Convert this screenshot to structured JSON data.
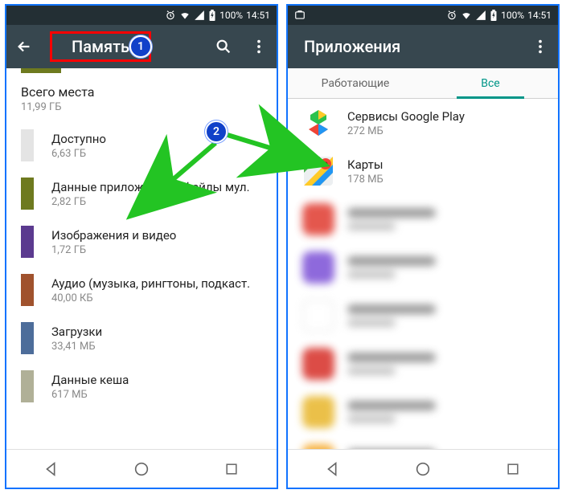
{
  "status": {
    "battery_pct": "100%",
    "time": "14:51"
  },
  "callouts": {
    "one": "1",
    "two": "2"
  },
  "left": {
    "title": "Память",
    "total": {
      "label": "Всего места",
      "value": "11,99 ГБ"
    },
    "rows": [
      {
        "label": "Доступно",
        "value": "6,63 ГБ",
        "color": "#e4e4e4"
      },
      {
        "label": "Данные приложений и файлы мул.",
        "value": "2,82 ГБ",
        "color": "#6e7a1f"
      },
      {
        "label": "Изображения и видео",
        "value": "1,72 ГБ",
        "color": "#5b3a8f"
      },
      {
        "label": "Аудио (музыка, рингтоны, подкаст.",
        "value": "40,00 КБ",
        "color": "#a0522d"
      },
      {
        "label": "Загрузки",
        "value": "33,41 МБ",
        "color": "#4d6d9a"
      },
      {
        "label": "Данные кеша",
        "value": "617 МБ",
        "color": "#b0b097"
      }
    ]
  },
  "right": {
    "title": "Приложения",
    "tabs": {
      "working": "Работающие",
      "all": "Все"
    },
    "apps": [
      {
        "label": "Сервисы Google Play",
        "size": "272 МБ",
        "icon": "play"
      },
      {
        "label": "Карты",
        "size": "178 МБ",
        "icon": "maps"
      }
    ],
    "blurred": [
      {
        "color": "#e03a2f"
      },
      {
        "color": "#7b4fd6"
      },
      {
        "color": "#ffffff"
      },
      {
        "color": "#d62d26"
      },
      {
        "color": "#e8b62a"
      },
      {
        "color": "#f5a623"
      }
    ]
  }
}
